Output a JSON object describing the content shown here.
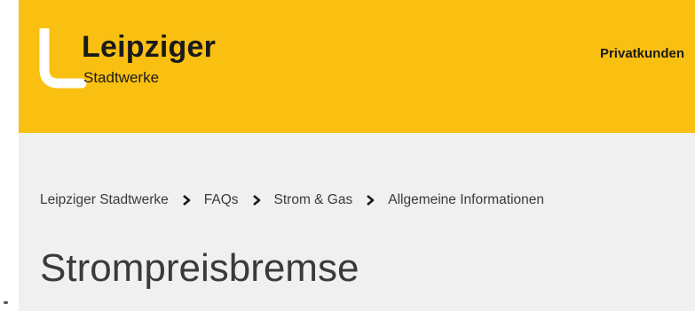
{
  "header": {
    "logo": {
      "title": "Leipziger",
      "subtitle": "Stadtwerke"
    },
    "nav": {
      "privatkunden": "Privatkunden"
    }
  },
  "breadcrumb": {
    "items": [
      "Leipziger Stadtwerke",
      "FAQs",
      "Strom & Gas",
      "Allgemeine Informationen"
    ]
  },
  "page": {
    "title": "Strompreisbremse"
  },
  "colors": {
    "brand_yellow": "#f9c011",
    "content_bg": "#f0f0f0",
    "text": "#3a3a3a",
    "logo_mark": "#ffffff"
  }
}
